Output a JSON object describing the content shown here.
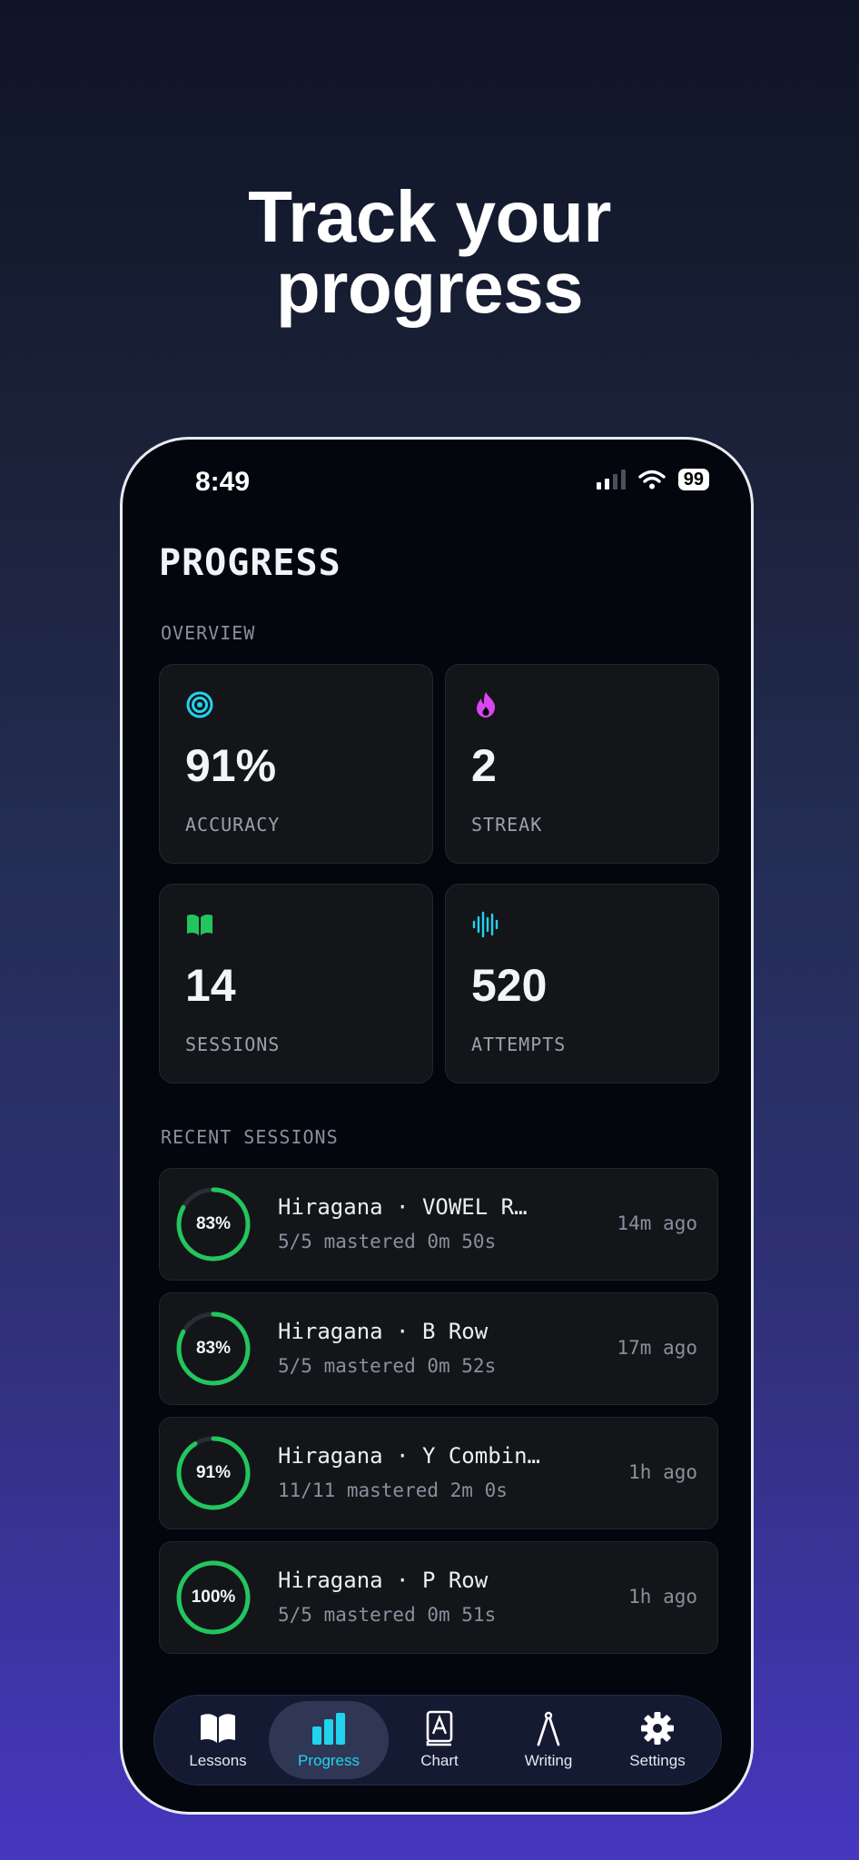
{
  "headline": {
    "line1": "Track your",
    "line2": "progress"
  },
  "status_bar": {
    "time": "8:49",
    "battery": "99"
  },
  "page_title": "PROGRESS",
  "overview": {
    "label": "OVERVIEW",
    "cards": [
      {
        "icon": "target-icon",
        "value": "91%",
        "label": "ACCURACY",
        "color": "#22d3ee"
      },
      {
        "icon": "flame-icon",
        "value": "2",
        "label": "STREAK",
        "color": "#d946ef"
      },
      {
        "icon": "book-icon",
        "value": "14",
        "label": "SESSIONS",
        "color": "#22c55e"
      },
      {
        "icon": "waveform-icon",
        "value": "520",
        "label": "ATTEMPTS",
        "color": "#22d3ee"
      }
    ]
  },
  "recent": {
    "label": "RECENT SESSIONS",
    "items": [
      {
        "percent": "83%",
        "progress": 0.83,
        "title": "Hiragana · VOWEL R…",
        "subtitle": "5/5 mastered 0m 50s",
        "time": "14m ago"
      },
      {
        "percent": "83%",
        "progress": 0.83,
        "title": "Hiragana · B Row",
        "subtitle": "5/5 mastered 0m 52s",
        "time": "17m ago"
      },
      {
        "percent": "91%",
        "progress": 0.91,
        "title": "Hiragana · Y Combin…",
        "subtitle": "11/11 mastered 2m 0s",
        "time": "1h ago"
      },
      {
        "percent": "100%",
        "progress": 1.0,
        "title": "Hiragana · P Row",
        "subtitle": "5/5 mastered 0m 51s",
        "time": "1h ago"
      }
    ]
  },
  "tabs": [
    {
      "label": "Lessons",
      "icon": "book-open-icon",
      "active": false
    },
    {
      "label": "Progress",
      "icon": "bar-chart-icon",
      "active": true
    },
    {
      "label": "Chart",
      "icon": "kana-chart-icon",
      "active": false
    },
    {
      "label": "Writing",
      "icon": "compass-pen-icon",
      "active": false
    },
    {
      "label": "Settings",
      "icon": "gear-icon",
      "active": false
    }
  ],
  "colors": {
    "ring": "#22c55e",
    "ring_track": "#2a2d35",
    "active_tab": "#22d3ee"
  }
}
